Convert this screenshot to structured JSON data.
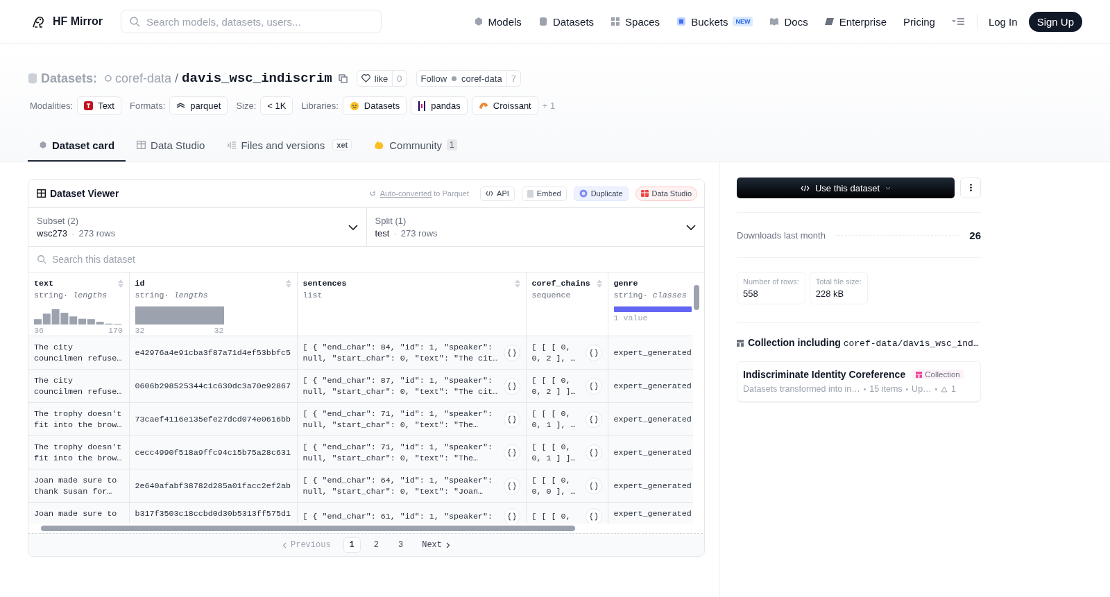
{
  "brand": "HF Mirror",
  "search": {
    "placeholder": "Search models, datasets, users..."
  },
  "nav": [
    {
      "label": "Models",
      "kind": "models"
    },
    {
      "label": "Datasets",
      "kind": "datasets"
    },
    {
      "label": "Spaces",
      "kind": "spaces"
    },
    {
      "label": "Buckets",
      "kind": "buckets",
      "badge": "NEW"
    },
    {
      "label": "Docs",
      "kind": "docs"
    },
    {
      "label": "Enterprise",
      "kind": "enterprise"
    },
    {
      "label": "Pricing",
      "kind": "plain"
    }
  ],
  "auth": {
    "login": "Log In",
    "signup": "Sign Up"
  },
  "heading": {
    "section": "Datasets:",
    "owner": "coref-data",
    "separator": "/",
    "name": "davis_wsc_indiscrim",
    "like_label": "like",
    "like_count": "0",
    "follow_label": "Follow",
    "follow_owner": "coref-data",
    "follow_count": "7"
  },
  "tag_groups": [
    {
      "label": "Modalities:",
      "tags": [
        {
          "text": "Text",
          "kind": "text"
        }
      ]
    },
    {
      "label": "Formats:",
      "tags": [
        {
          "text": "parquet",
          "kind": "parquet"
        }
      ]
    },
    {
      "label": "Size:",
      "tags": [
        {
          "text": "< 1K",
          "kind": "plain"
        }
      ]
    },
    {
      "label": "Libraries:",
      "tags": [
        {
          "text": "Datasets",
          "kind": "hf"
        },
        {
          "text": "pandas",
          "kind": "pandas"
        },
        {
          "text": "Croissant",
          "kind": "croissant"
        }
      ]
    }
  ],
  "more_libraries": "+ 1",
  "tabs": [
    {
      "label": "Dataset card",
      "kind": "card",
      "selected": true
    },
    {
      "label": "Data Studio",
      "kind": "table",
      "selected": false
    },
    {
      "label": "Files and versions",
      "kind": "files",
      "selected": false,
      "badge": "xet"
    },
    {
      "label": "Community",
      "kind": "community",
      "selected": false,
      "count": "1"
    }
  ],
  "viewer": {
    "title": "Dataset Viewer",
    "converted_link": "Auto-converted",
    "converted_rest": " to Parquet",
    "actions": [
      {
        "label": "API",
        "kind": "api"
      },
      {
        "label": "Embed",
        "kind": "embed"
      },
      {
        "label": "Duplicate",
        "kind": "duplicate"
      },
      {
        "label": "Data Studio",
        "kind": "studio"
      }
    ],
    "selectors": [
      {
        "label": "Subset (2)",
        "value": "wsc273",
        "separator": "·",
        "rows": "273 rows"
      },
      {
        "label": "Split (1)",
        "value": "test",
        "separator": "·",
        "rows": "273 rows"
      }
    ],
    "search_placeholder": "Search this dataset",
    "columns": [
      {
        "name": "text",
        "type": "string",
        "separator": "·",
        "hint": "lengths",
        "kind": "histogram",
        "min": "36",
        "max": "170"
      },
      {
        "name": "id",
        "type": "string",
        "separator": "·",
        "hint": "lengths",
        "kind": "bar",
        "min": "32",
        "max": "32"
      },
      {
        "name": "sentences",
        "type": "list",
        "kind": "none"
      },
      {
        "name": "coref_chains",
        "type": "sequence",
        "kind": "none"
      },
      {
        "name": "genre",
        "type": "string",
        "separator": "·",
        "hint": "classes",
        "kind": "classes",
        "note": "1 value"
      }
    ],
    "rows": [
      [
        "The city councilmen refuse…",
        "e42976a4e91cba3f87a71d4ef53bbfc5",
        "[ { \"end_char\": 84, \"id\": 1, \"speaker\": null, \"start_char\": 0, \"text\": \"The cit…",
        "[ [ [ 0, 0, 2 ], …",
        "expert_generated"
      ],
      [
        "The city councilmen refuse…",
        "0606b298525344c1c630dc3a70e92867",
        "[ { \"end_char\": 87, \"id\": 1, \"speaker\": null, \"start_char\": 0, \"text\": \"The cit…",
        "[ [ [ 0, 0, 2 ] ]…",
        "expert_generated"
      ],
      [
        "The trophy doesn't fit into the brow…",
        "73caef4116e135efe27dcd074e0616bb",
        "[ { \"end_char\": 71, \"id\": 1, \"speaker\": null, \"start_char\": 0, \"text\": \"The…",
        "[ [ [ 0, 0, 1 ], …",
        "expert_generated"
      ],
      [
        "The trophy doesn't fit into the brow…",
        "cecc4990f518a9ffc94c15b75a28c631",
        "[ { \"end_char\": 71, \"id\": 1, \"speaker\": null, \"start_char\": 0, \"text\": \"The…",
        "[ [ [ 0, 0, 1 ] ]…",
        "expert_generated"
      ],
      [
        "Joan made sure to thank Susan for…",
        "2e640afabf38782d285a01facc2ef2ab",
        "[ { \"end_char\": 64, \"id\": 1, \"speaker\": null, \"start_char\": 0, \"text\": \"Joan…",
        "[ [ [ 0, 0, 0 ], …",
        "expert_generated"
      ],
      [
        "Joan made sure to",
        "b317f3503c18ccbd0d30b5313ff575d1",
        "[ { \"end_char\": 61, \"id\": 1, \"speaker\":",
        "[ [ [ 0,",
        "expert_generated"
      ]
    ],
    "pagination": {
      "previous": "Previous",
      "next": "Next",
      "pages": [
        {
          "label": "1",
          "selected": true
        },
        {
          "label": "2",
          "selected": false
        },
        {
          "label": "3",
          "selected": false
        }
      ]
    }
  },
  "sidebar": {
    "use_button": "Use this dataset",
    "downloads_label": "Downloads last month",
    "downloads": "26",
    "stats": [
      {
        "label": "Number of rows:",
        "value": "558"
      },
      {
        "label": "Total file size:",
        "value": "228 kB"
      }
    ],
    "collection_heading": "Collection including",
    "collection_path": "coref-data/davis_wsc_ind…",
    "collection": {
      "title": "Indiscriminate Identity Coreference",
      "badge": "Collection",
      "description": "Datasets transformed into in…",
      "separator": "•",
      "items": "15 items",
      "updated": "Up…",
      "upvotes": "1"
    }
  }
}
